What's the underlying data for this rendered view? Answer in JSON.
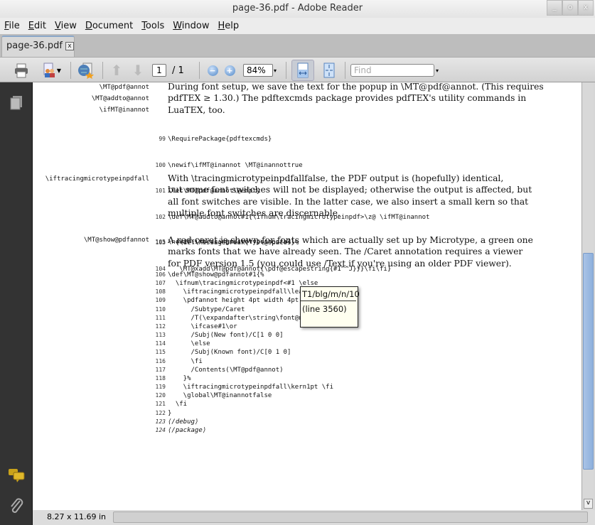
{
  "window": {
    "title": "page-36.pdf - Adobe Reader",
    "controls": [
      "_",
      "o",
      "x"
    ]
  },
  "menu": [
    "File",
    "Edit",
    "View",
    "Document",
    "Tools",
    "Window",
    "Help"
  ],
  "tab": {
    "label": "page-36.pdf",
    "close": "x"
  },
  "toolbar": {
    "page_current": "1",
    "page_total": "/ 1",
    "zoom": "84%",
    "find_placeholder": "Find",
    "dropdown": "▾"
  },
  "status": {
    "page_size": "8.27 x 11.69 in"
  },
  "document": {
    "margin_labels": [
      "\\MT@pdf@annot",
      "\\MT@addto@annot",
      "\\ifMT@inannot",
      "\\iftracingmicrotypeinpdfall",
      "\\MT@show@pdfannot"
    ],
    "para1": [
      "During font setup, we save the text for the popup in \\MT@pdf@annot. (This requires",
      "pdfTEX ≥ 1.30.) The pdftexcmds package provides pdfTEX's utility commands in",
      "LuaTEX, too."
    ],
    "code1": [
      {
        "n": "99",
        "t": "\\RequirePackage{pdftexcmds}"
      },
      {
        "n": "100",
        "t": "\\newif\\ifMT@inannot \\MT@inannottrue"
      },
      {
        "n": "101",
        "t": "\\let\\MT@pdf@annot\\@empty"
      },
      {
        "n": "102",
        "t": "\\def\\MT@addto@annot#1{\\ifnum\\tracingmicrotypeinpdf>\\z@ \\ifMT@inannot"
      },
      {
        "n": "103",
        "t": "  {\\def\\MessageBreak{^^J\\@spaces}%"
      },
      {
        "n": "104",
        "t": "   \\MT@xadd\\MT@pdf@annot{\\pdf@escapestring{#1^^J}}}\\fi\\fi}"
      }
    ],
    "para2": [
      "With \\tracingmicrotypeinpdfallfalse, the PDF output is (hopefully) identical,",
      "but some font switches will not be displayed; otherwise the output is affected, but",
      "all font switches are visible. In the latter case, we also insert a small kern so that",
      "multiple font switches are discernable."
    ],
    "code2": [
      {
        "n": "105",
        "t": "\\newif\\iftracingmicrotypeinpdfall"
      }
    ],
    "para3": [
      "A red caret is shown for fonts which are actually set up by Microtype, a green one",
      "marks fonts that we have already seen. The /Caret annotation requires a viewer",
      "for PDF version 1.5 (you could use /Text if you're using an older PDF viewer)."
    ],
    "code3": [
      {
        "n": "106",
        "t": "\\def\\MT@show@pdfannot#1{%"
      },
      {
        "n": "107",
        "t": "  \\ifnum\\tracingmicrotypeinpdf<#1 \\else"
      },
      {
        "n": "108",
        "t": "    \\iftracingmicrotypeinpdfall\\leave"
      },
      {
        "n": "109",
        "t": "    \\pdfannot height 4pt width 4pt de"
      },
      {
        "n": "110",
        "t": "      /Subtype/Caret"
      },
      {
        "n": "111",
        "t": "      /T(\\expandafter\\string\\font@nam"
      },
      {
        "n": "112",
        "t": "      \\ifcase#1\\or"
      },
      {
        "n": "113",
        "t": "      /Subj(New font)/C[1 0 0]"
      },
      {
        "n": "114",
        "t": "      \\else"
      },
      {
        "n": "115",
        "t": "      /Subj(Known font)/C[0 1 0]"
      },
      {
        "n": "116",
        "t": "      \\fi"
      },
      {
        "n": "117",
        "t": "      /Contents(\\MT@pdf@annot)"
      },
      {
        "n": "118",
        "t": "    }%"
      },
      {
        "n": "119",
        "t": "    \\iftracingmicrotypeinpdfall\\kern1pt \\fi"
      },
      {
        "n": "120",
        "t": "    \\global\\MT@inannotfalse"
      },
      {
        "n": "121",
        "t": "  \\fi"
      },
      {
        "n": "122",
        "t": "}"
      },
      {
        "n": "123",
        "t": "⟨/debug⟩"
      },
      {
        "n": "124",
        "t": "⟨/package⟩"
      }
    ]
  },
  "popup": {
    "title": "T1/blg/m/n/10",
    "body": "(line 3560)"
  }
}
